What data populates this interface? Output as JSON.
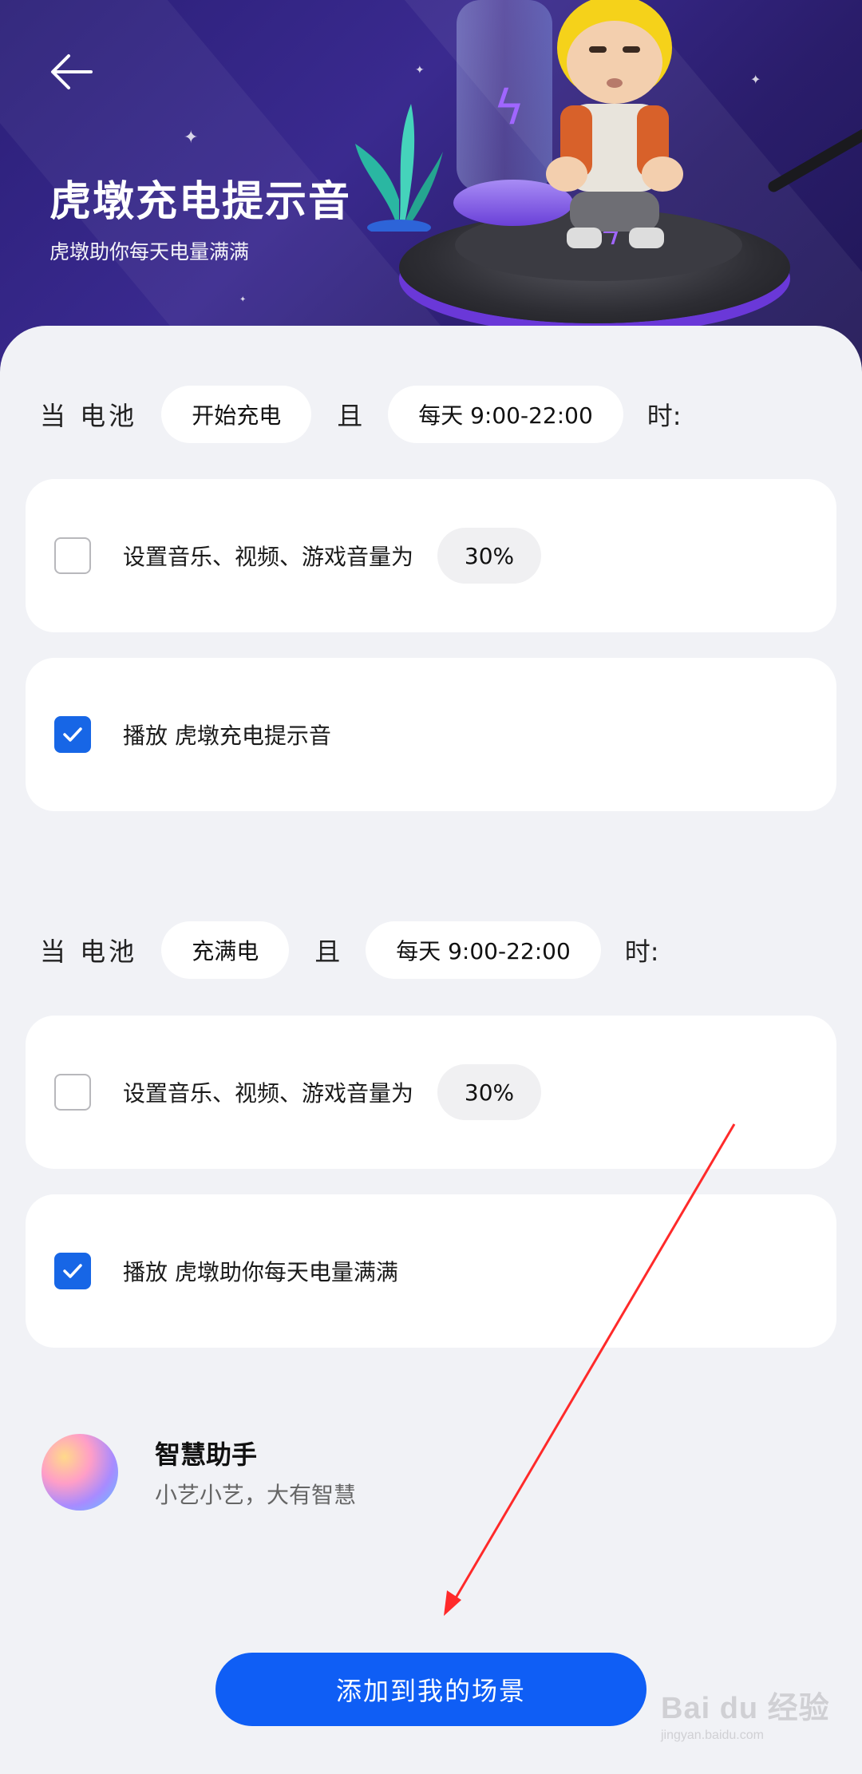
{
  "header": {
    "title": "虎墩充电提示音",
    "subtitle": "虎墩助你每天电量满满"
  },
  "scene1": {
    "prefix": "当 电池",
    "trigger": "开始充电",
    "and": "且",
    "schedule": "每天 9:00-22:00",
    "suffix": "时:",
    "action1": {
      "label": "设置音乐、视频、游戏音量为",
      "value": "30%",
      "checked": false
    },
    "action2": {
      "label": "播放 虎墩充电提示音",
      "checked": true
    }
  },
  "scene2": {
    "prefix": "当 电池",
    "trigger": "充满电",
    "and": "且",
    "schedule": "每天 9:00-22:00",
    "suffix": "时:",
    "action1": {
      "label": "设置音乐、视频、游戏音量为",
      "value": "30%",
      "checked": false
    },
    "action2": {
      "label": "播放 虎墩助你每天电量满满",
      "checked": true
    }
  },
  "assistant": {
    "name": "智慧助手",
    "slogan": "小艺小艺，大有智慧"
  },
  "cta": {
    "label": "添加到我的场景"
  },
  "watermark": {
    "main": "Bai du 经验",
    "sub": "jingyan.baidu.com"
  },
  "colors": {
    "accent": "#0f5ef5",
    "checkbox_on": "#1766e6",
    "annotation_arrow": "#ff2a2a",
    "hero_bg": "#2b1f78"
  },
  "icons": [
    "back-arrow-icon",
    "checkbox-empty-icon",
    "checkmark-icon",
    "assistant-orb-icon",
    "lightning-bolt-icon"
  ]
}
